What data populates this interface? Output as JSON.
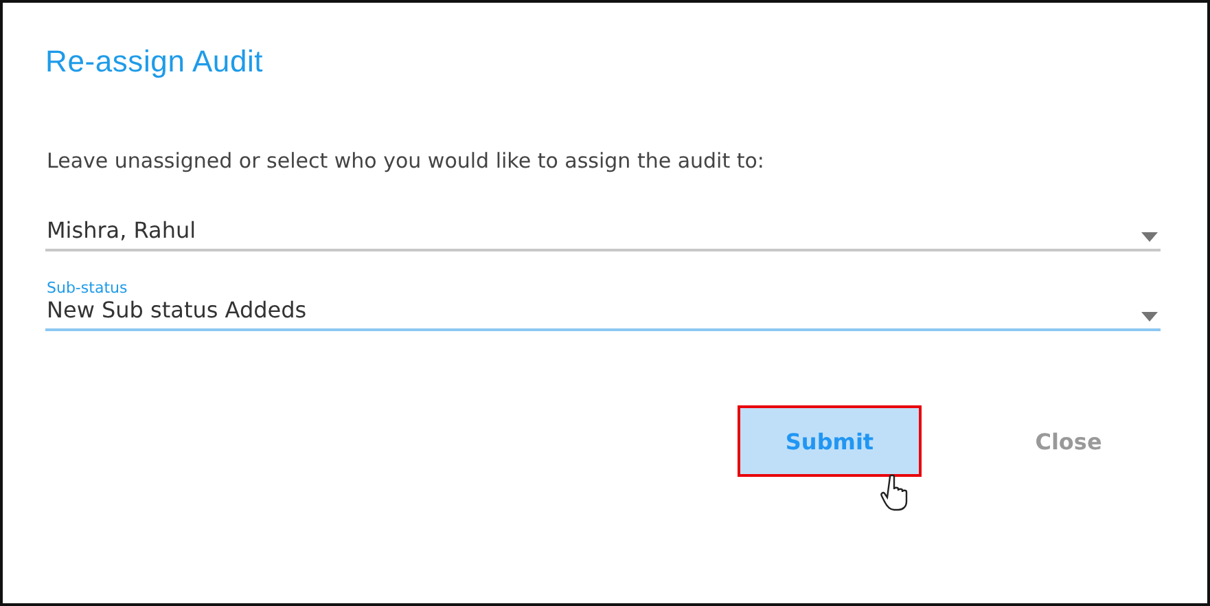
{
  "dialog": {
    "title": "Re-assign Audit",
    "instruction": "Leave unassigned or select who you would like to assign the audit to:",
    "fields": [
      {
        "value": "Mishra, Rahul",
        "focused": false
      },
      {
        "label": "Sub-status",
        "value": "New Sub status Addeds",
        "focused": true
      }
    ],
    "buttons": [
      {
        "label": "Submit",
        "highlighted": true
      },
      {
        "label": "Close",
        "highlighted": false
      }
    ]
  }
}
